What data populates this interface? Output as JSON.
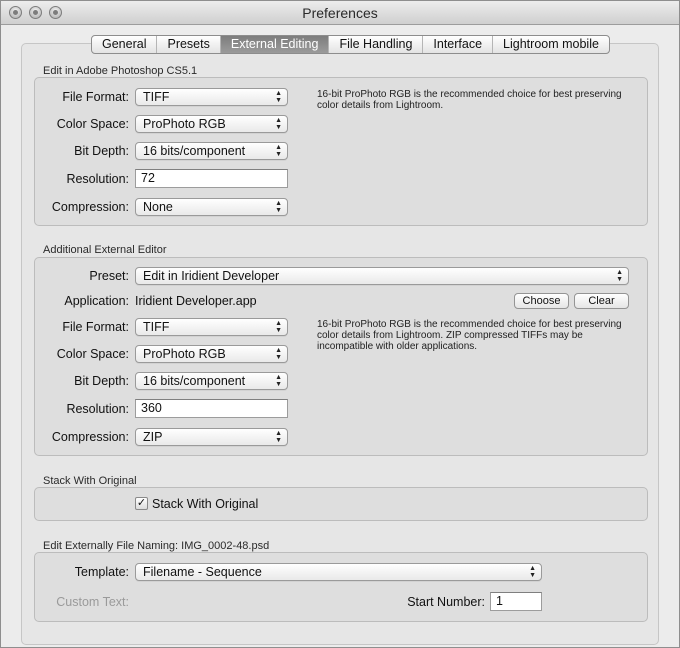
{
  "window": {
    "title": "Preferences"
  },
  "tabs": [
    {
      "label": "General"
    },
    {
      "label": "Presets"
    },
    {
      "label": "External Editing",
      "active": true
    },
    {
      "label": "File Handling"
    },
    {
      "label": "Interface"
    },
    {
      "label": "Lightroom mobile"
    }
  ],
  "photoshop": {
    "header": "Edit in Adobe Photoshop CS5.1",
    "file_format_label": "File Format:",
    "file_format_value": "TIFF",
    "color_space_label": "Color Space:",
    "color_space_value": "ProPhoto RGB",
    "bit_depth_label": "Bit Depth:",
    "bit_depth_value": "16 bits/component",
    "resolution_label": "Resolution:",
    "resolution_value": "72",
    "compression_label": "Compression:",
    "compression_value": "None",
    "note_line1": "16-bit ProPhoto RGB is the recommended choice for best preserving",
    "note_line2": "color details from Lightroom."
  },
  "additional": {
    "header": "Additional External Editor",
    "preset_label": "Preset:",
    "preset_value": "Edit in Iridient Developer",
    "application_label": "Application:",
    "application_value": "Iridient Developer.app",
    "choose_label": "Choose",
    "clear_label": "Clear",
    "file_format_label": "File Format:",
    "file_format_value": "TIFF",
    "color_space_label": "Color Space:",
    "color_space_value": "ProPhoto RGB",
    "bit_depth_label": "Bit Depth:",
    "bit_depth_value": "16 bits/component",
    "resolution_label": "Resolution:",
    "resolution_value": "360",
    "compression_label": "Compression:",
    "compression_value": "ZIP",
    "note_line1": "16-bit ProPhoto RGB is the recommended choice for best preserving",
    "note_line2": "color details from Lightroom. ZIP compressed TIFFs may be",
    "note_line3": "incompatible with older applications."
  },
  "stack": {
    "header": "Stack With Original",
    "checkbox_label": "Stack With Original",
    "checked": true,
    "check_glyph": "✓"
  },
  "naming": {
    "header": "Edit Externally File Naming:  IMG_0002-48.psd",
    "template_label": "Template:",
    "template_value": "Filename - Sequence",
    "custom_text_label": "Custom Text:",
    "start_number_label": "Start Number:",
    "start_number_value": "1"
  },
  "icons": {
    "select_arrows": "▲▼"
  }
}
